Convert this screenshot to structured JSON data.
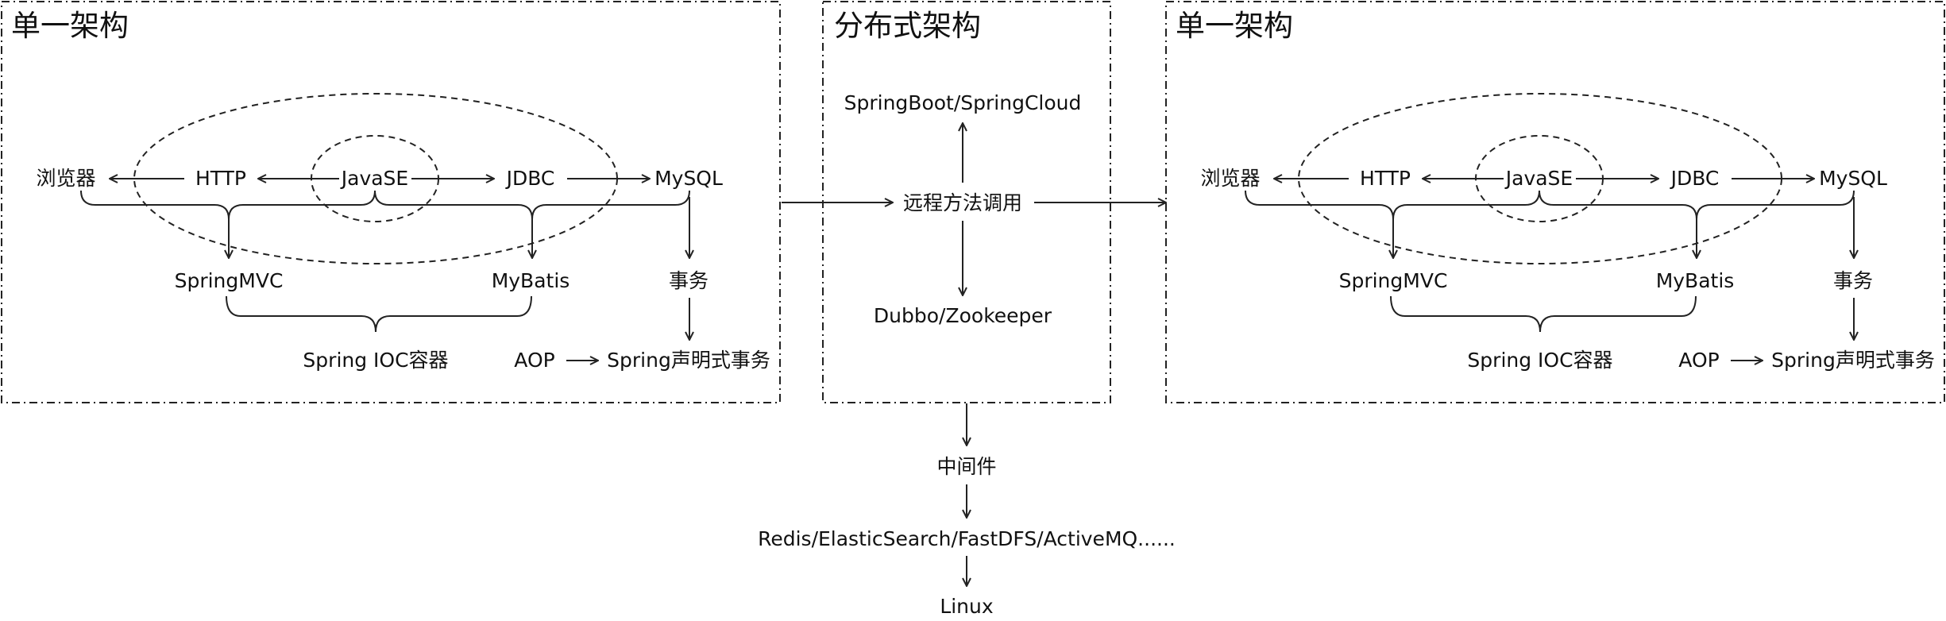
{
  "left": {
    "title": "单一架构",
    "browser": "浏览器",
    "http": "HTTP",
    "javase": "JavaSE",
    "jdbc": "JDBC",
    "mysql": "MySQL",
    "springmvc": "SpringMVC",
    "mybatis": "MyBatis",
    "transaction": "事务",
    "ioc": "Spring IOC容器",
    "aop": "AOP",
    "declarative_tx": "Spring声明式事务"
  },
  "middle": {
    "title": "分布式架构",
    "springboot": "SpringBoot/SpringCloud",
    "rpc": "远程方法调用",
    "dubbo": "Dubbo/Zookeeper"
  },
  "right": {
    "title": "单一架构",
    "browser": "浏览器",
    "http": "HTTP",
    "javase": "JavaSE",
    "jdbc": "JDBC",
    "mysql": "MySQL",
    "springmvc": "SpringMVC",
    "mybatis": "MyBatis",
    "transaction": "事务",
    "ioc": "Spring IOC容器",
    "aop": "AOP",
    "declarative_tx": "Spring声明式事务"
  },
  "bottom": {
    "middleware": "中间件",
    "tools": "Redis/ElasticSearch/FastDFS/ActiveMQ......",
    "linux": "Linux"
  }
}
